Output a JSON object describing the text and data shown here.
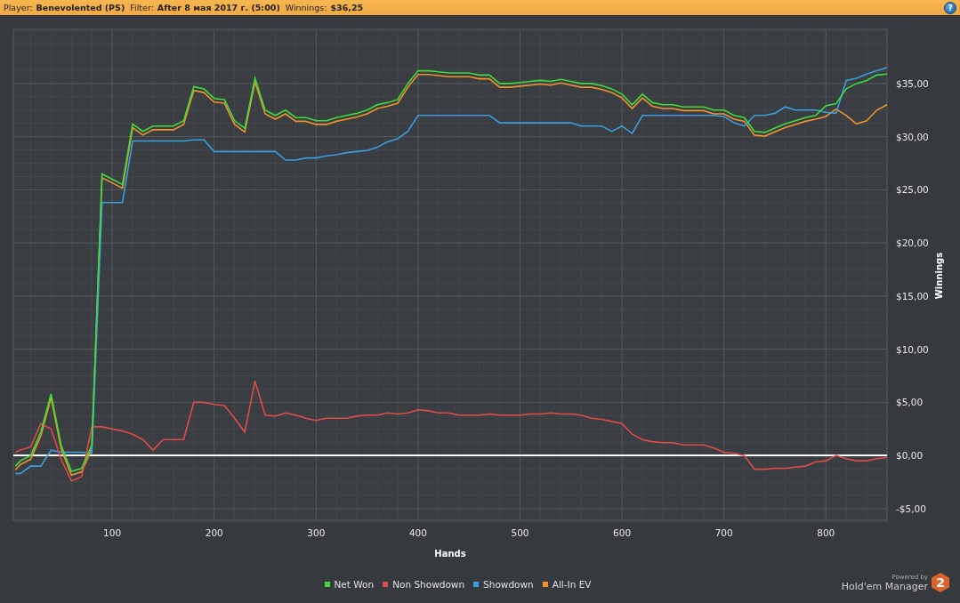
{
  "header": {
    "fields": [
      {
        "label": "Player:",
        "value": "Benevolented (PS)"
      },
      {
        "label": "Filter:",
        "value": "After 8 мая 2017 г. (5:00)"
      },
      {
        "label": "Winnings:",
        "value": "$36,25"
      }
    ],
    "help": "?"
  },
  "chart": {
    "chart_data": {
      "type": "line",
      "xlabel": "Hands",
      "ylabel": "Winnings",
      "grid": true,
      "x": [
        5,
        10,
        20,
        30,
        40,
        50,
        60,
        70,
        80,
        90,
        100,
        110,
        120,
        130,
        140,
        150,
        160,
        170,
        180,
        190,
        200,
        210,
        220,
        230,
        240,
        250,
        260,
        270,
        280,
        290,
        300,
        310,
        320,
        330,
        340,
        350,
        360,
        370,
        380,
        390,
        400,
        410,
        420,
        430,
        440,
        450,
        460,
        470,
        480,
        490,
        500,
        510,
        520,
        530,
        540,
        550,
        560,
        570,
        580,
        590,
        600,
        610,
        620,
        630,
        640,
        650,
        660,
        670,
        680,
        690,
        700,
        710,
        720,
        730,
        740,
        750,
        760,
        770,
        780,
        790,
        800,
        810,
        820,
        830,
        840,
        850,
        860
      ],
      "series": [
        {
          "name": "Net Won",
          "color": "#3ddc3d",
          "values": [
            -1,
            -0.5,
            0,
            2.2,
            5.8,
            0.9,
            -1.5,
            -1.2,
            1.0,
            26.5,
            26,
            25.5,
            31.2,
            30.5,
            31,
            31,
            31,
            31.5,
            34.7,
            34.5,
            33.6,
            33.5,
            31.5,
            30.8,
            35.5,
            32.5,
            32,
            32.5,
            31.8,
            31.8,
            31.5,
            31.5,
            31.8,
            32,
            32.2,
            32.5,
            33,
            33.2,
            33.5,
            35,
            36.2,
            36.2,
            36.1,
            36,
            36,
            36,
            35.8,
            35.8,
            35,
            35,
            35.1,
            35.2,
            35.3,
            35.2,
            35.4,
            35.2,
            35,
            35,
            34.8,
            34.5,
            34,
            33,
            34,
            33.2,
            33,
            33,
            32.8,
            32.8,
            32.8,
            32.5,
            32.5,
            32,
            31.8,
            30.5,
            30.4,
            30.8,
            31.2,
            31.5,
            31.8,
            32,
            32.9,
            33.1,
            34.5,
            35,
            35.3,
            35.8,
            35.9
          ]
        },
        {
          "name": "Non Showdown",
          "color": "#e04b4b",
          "values": [
            0.3,
            0.5,
            0.8,
            3,
            2.5,
            -0.4,
            -2.4,
            -2.0,
            2.7,
            2.7,
            2.5,
            2.3,
            2,
            1.5,
            0.5,
            1.5,
            1.5,
            1.5,
            5,
            5,
            4.8,
            4.7,
            3.5,
            2.2,
            7,
            3.8,
            3.7,
            4,
            3.8,
            3.5,
            3.3,
            3.5,
            3.5,
            3.5,
            3.7,
            3.8,
            3.8,
            4,
            3.9,
            4,
            4.3,
            4.2,
            4,
            4,
            3.8,
            3.8,
            3.8,
            3.9,
            3.8,
            3.8,
            3.8,
            3.9,
            3.9,
            4,
            3.9,
            3.9,
            3.8,
            3.5,
            3.4,
            3.2,
            3,
            2,
            1.5,
            1.3,
            1.2,
            1.2,
            1,
            1,
            1,
            0.7,
            0.3,
            0.2,
            0,
            -1.3,
            -1.3,
            -1.2,
            -1.2,
            -1.1,
            -1,
            -0.6,
            -0.5,
            0,
            -0.3,
            -0.5,
            -0.5,
            -0.3,
            -0.2
          ]
        },
        {
          "name": "Showdown",
          "color": "#3a9ee0",
          "values": [
            -1.7,
            -1.7,
            -1,
            -1,
            0.5,
            0.3,
            0.3,
            0.3,
            0.2,
            23.8,
            23.8,
            23.8,
            29.6,
            29.6,
            29.6,
            29.6,
            29.6,
            29.6,
            29.7,
            29.7,
            28.6,
            28.6,
            28.6,
            28.6,
            28.6,
            28.6,
            28.6,
            27.8,
            27.8,
            28,
            28,
            28.2,
            28.3,
            28.5,
            28.6,
            28.7,
            29,
            29.5,
            29.8,
            30.5,
            32,
            32,
            32,
            32,
            32,
            32,
            32,
            32,
            31.3,
            31.3,
            31.3,
            31.3,
            31.3,
            31.3,
            31.3,
            31.3,
            31,
            31,
            31,
            30.5,
            31,
            30.3,
            32,
            32,
            32,
            32,
            32,
            32,
            32,
            32,
            31.9,
            31.3,
            31,
            32,
            32,
            32.2,
            32.8,
            32.5,
            32.5,
            32.5,
            32.3,
            32.2,
            35.3,
            35.5,
            35.9,
            36.2,
            36.5
          ]
        },
        {
          "name": "All-In EV",
          "color": "#f0932b",
          "values": [
            -1.35,
            -0.85,
            -0.35,
            1.85,
            5.45,
            0.55,
            -1.85,
            -1.55,
            0.65,
            26.15,
            25.65,
            25.15,
            30.85,
            30.15,
            30.65,
            30.65,
            30.65,
            31.15,
            34.35,
            34.15,
            33.25,
            33.15,
            31.15,
            30.45,
            35.15,
            32.15,
            31.65,
            32.15,
            31.45,
            31.45,
            31.15,
            31.15,
            31.45,
            31.65,
            31.85,
            32.15,
            32.65,
            32.85,
            33.15,
            34.65,
            35.85,
            35.85,
            35.75,
            35.65,
            35.65,
            35.65,
            35.45,
            35.45,
            34.65,
            34.65,
            34.75,
            34.85,
            34.95,
            34.85,
            35.05,
            34.85,
            34.65,
            34.65,
            34.45,
            34.15,
            33.65,
            32.65,
            33.65,
            32.85,
            32.65,
            32.65,
            32.45,
            32.45,
            32.45,
            32.15,
            32.15,
            31.65,
            31.45,
            30.15,
            30.05,
            30.45,
            30.85,
            31.15,
            31.45,
            31.65,
            31.9,
            32.6,
            32,
            31.2,
            31.5,
            32.5,
            33
          ]
        }
      ],
      "xlim": [
        3,
        860
      ],
      "ylim": [
        -6.1,
        40.1
      ],
      "xticks": [
        100,
        200,
        300,
        400,
        500,
        600,
        700,
        800
      ],
      "yticks": [
        {
          "value": -5,
          "label": "-$5,00"
        },
        {
          "value": 0,
          "label": "$0,00"
        },
        {
          "value": 5,
          "label": "$5,00"
        },
        {
          "value": 10,
          "label": "$10,00"
        },
        {
          "value": 15,
          "label": "$15,00"
        },
        {
          "value": 20,
          "label": "$20,00"
        },
        {
          "value": 25,
          "label": "$25,00"
        },
        {
          "value": 30,
          "label": "$30,00"
        },
        {
          "value": 35,
          "label": "$35,00"
        }
      ]
    }
  },
  "branding": {
    "powered_by": "Powered by",
    "product": "Hold'em Manager",
    "logo_mark": "2"
  }
}
